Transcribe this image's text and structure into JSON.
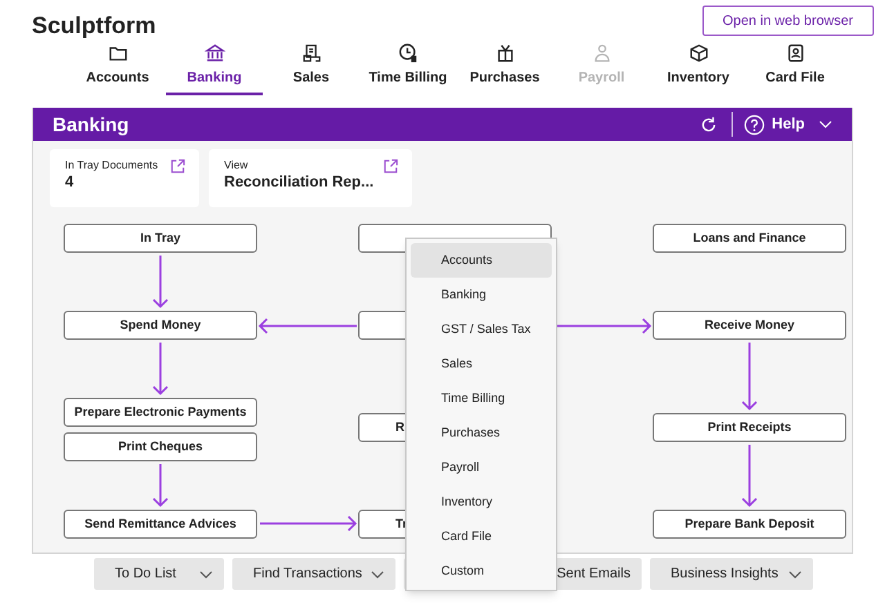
{
  "company": "Sculptform",
  "open_browser_button": "Open in web browser",
  "nav_tabs": [
    {
      "label": "Accounts",
      "selected": false,
      "disabled": false
    },
    {
      "label": "Banking",
      "selected": true,
      "disabled": false
    },
    {
      "label": "Sales",
      "selected": false,
      "disabled": false
    },
    {
      "label": "Time Billing",
      "selected": false,
      "disabled": false
    },
    {
      "label": "Purchases",
      "selected": false,
      "disabled": false
    },
    {
      "label": "Payroll",
      "selected": false,
      "disabled": true
    },
    {
      "label": "Inventory",
      "selected": false,
      "disabled": false
    },
    {
      "label": "Card File",
      "selected": false,
      "disabled": false
    }
  ],
  "header": {
    "title": "Banking",
    "help": "Help"
  },
  "cards": [
    {
      "caption": "In Tray Documents",
      "value": "4"
    },
    {
      "caption": "View",
      "value": "Reconciliation Rep..."
    }
  ],
  "flow_columns": [
    {
      "nodes": [
        {
          "label": "In Tray"
        },
        {
          "label": "Spend Money"
        },
        {
          "label": "Prepare Electronic Payments"
        },
        {
          "label": "Print Cheques"
        },
        {
          "label": "Send Remittance Advices"
        }
      ]
    },
    {
      "nodes": [
        {
          "kind": "blank"
        },
        {
          "kind": "blank"
        },
        {
          "kind": "text",
          "label": "R"
        },
        {
          "kind": "text",
          "label": "Tr"
        }
      ]
    },
    {
      "nodes": [
        {
          "label": "Loans and Finance"
        },
        {
          "label": "Receive Money"
        },
        {
          "label": "Print Receipts"
        },
        {
          "label": "Prepare Bank Deposit"
        }
      ]
    }
  ],
  "bottom_buttons": [
    {
      "label": "To Do List",
      "dropdown": true
    },
    {
      "label": "Find Transactions",
      "dropdown": true
    },
    {
      "label": "Sent Emails",
      "dropdown": false
    },
    {
      "label": "Business Insights",
      "dropdown": true
    }
  ],
  "menu": [
    {
      "label": "Accounts",
      "selected": true
    },
    {
      "label": "Banking",
      "selected": false
    },
    {
      "label": "GST / Sales Tax",
      "selected": false
    },
    {
      "label": "Sales",
      "selected": false
    },
    {
      "label": "Time Billing",
      "selected": false
    },
    {
      "label": "Purchases",
      "selected": false
    },
    {
      "label": "Payroll",
      "selected": false
    },
    {
      "label": "Inventory",
      "selected": false
    },
    {
      "label": "Card File",
      "selected": false
    },
    {
      "label": "Custom",
      "selected": false
    }
  ]
}
